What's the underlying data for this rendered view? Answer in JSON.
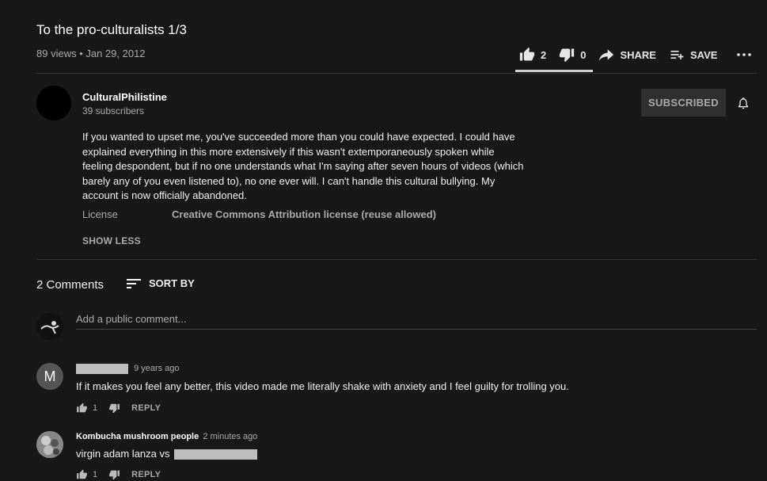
{
  "video": {
    "title": "To the pro-culturalists 1/3",
    "views": "89 views",
    "separator": " • ",
    "date": "Jan 29, 2012",
    "likes": "2",
    "dislikes": "0",
    "share_label": "SHARE",
    "save_label": "SAVE",
    "like_fraction": 1.0
  },
  "channel": {
    "name": "CulturalPhilistine",
    "subscribers": "39 subscribers",
    "subscribe_label": "SUBSCRIBED"
  },
  "description": {
    "text": "If you wanted to upset me, you've succeeded more than you could have expected. I could have explained everything in this more extensively if this wasn't extemporaneously spoken while feeling despondent, but if no one understands what I'm saying after seven hours of videos (which barely any of you even listened to), no one ever will. I can't handle this cultural bullying. My account is now officially abandoned.",
    "license_label": "License",
    "license_value": "Creative Commons Attribution license (reuse allowed)",
    "show_less": "SHOW LESS"
  },
  "comments_section": {
    "count_label": "2 Comments",
    "sort_label": "SORT BY",
    "add_placeholder": "Add a public comment..."
  },
  "comments": [
    {
      "avatar_letter": "M",
      "time": "9 years ago",
      "text": "If it makes you feel any better, this video made me literally shake with anxiety and I feel guilty for trolling you.",
      "likes": "1",
      "reply": "REPLY"
    },
    {
      "author": "Kombucha mushroom people",
      "time": "2 minutes ago",
      "text": "virgin adam lanza vs",
      "likes": "1",
      "reply": "REPLY"
    }
  ]
}
